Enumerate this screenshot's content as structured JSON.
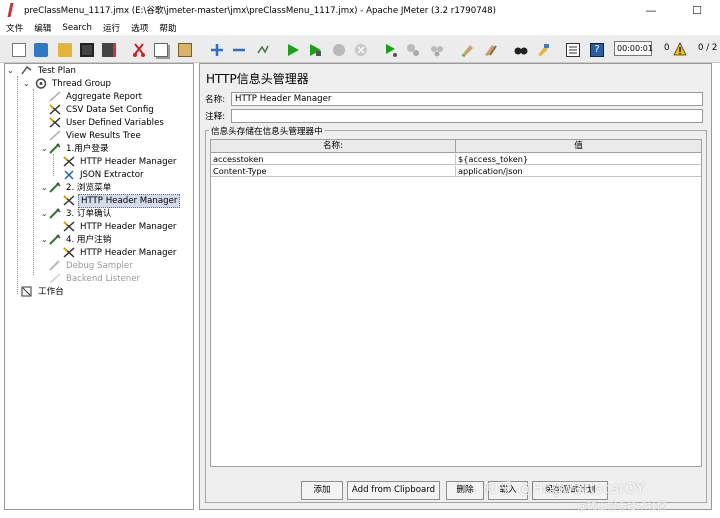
{
  "window": {
    "title": "preClassMenu_1117.jmx (E:\\谷歌\\jmeter-master\\jmx\\preClassMenu_1117.jmx) - Apache JMeter (3.2 r1790748)",
    "minimize": "—",
    "maximize": "☐",
    "close": "✕"
  },
  "menu": [
    "文件",
    "编辑",
    "Search",
    "运行",
    "选项",
    "帮助"
  ],
  "toolbar": {
    "timer": "00:00:01",
    "errors": "0",
    "threads": "0 / 2",
    "warning_color": "#f2c200",
    "run_color": "#1aa31a",
    "stop_color": "#b8b8b8",
    "icons": [
      "new-icon",
      "templates-icon",
      "open-icon",
      "save-icon",
      "save-as-icon",
      "cut-icon",
      "copy-icon",
      "paste-icon",
      "expand-icon",
      "collapse-icon",
      "toggle-icon",
      "start-icon",
      "start-no-pause-icon",
      "stop-icon",
      "shutdown-icon",
      "remote-start-icon",
      "remote-stop-icon",
      "remote-shutdown-icon",
      "clear-icon",
      "clear-all-icon",
      "search-icon",
      "reset-search-icon",
      "function-helper-icon",
      "help-icon"
    ]
  },
  "tree": [
    {
      "label": "Test Plan",
      "icon": "test-plan-icon"
    },
    {
      "label": "Thread Group",
      "icon": "thread-group-icon"
    },
    {
      "label": "Aggregate Report",
      "icon": "listener-icon"
    },
    {
      "label": "CSV Data Set Config",
      "icon": "config-icon"
    },
    {
      "label": "User Defined Variables",
      "icon": "config-icon"
    },
    {
      "label": "View Results Tree",
      "icon": "listener-icon"
    },
    {
      "label": "1.用户登录",
      "icon": "sampler-icon"
    },
    {
      "label": "HTTP Header Manager",
      "icon": "config-icon"
    },
    {
      "label": "JSON Extractor",
      "icon": "extractor-icon"
    },
    {
      "label": "2. 浏览菜单",
      "icon": "sampler-icon"
    },
    {
      "label": "HTTP Header Manager",
      "icon": "config-icon",
      "selected": true
    },
    {
      "label": "3. 订单确认",
      "icon": "sampler-icon"
    },
    {
      "label": "HTTP Header Manager",
      "icon": "config-icon"
    },
    {
      "label": "4. 用户注销",
      "icon": "sampler-icon"
    },
    {
      "label": "HTTP Header Manager",
      "icon": "config-icon"
    },
    {
      "label": "Debug Sampler",
      "icon": "sampler-icon",
      "disabled": true
    },
    {
      "label": "Backend Listener",
      "icon": "listener-icon",
      "disabled": true
    },
    {
      "label": "工作台",
      "icon": "workbench-icon"
    }
  ],
  "panel": {
    "title": "HTTP信息头管理器",
    "name_label": "名称:",
    "name_value": "HTTP Header Manager",
    "comment_label": "注释:",
    "comment_value": "",
    "group_title": "信息头存储在信息头管理器中",
    "columns": [
      "名称:",
      "值"
    ],
    "rows": [
      [
        "accesstoken",
        "${access_token}"
      ],
      [
        "Content-Type",
        "application/json"
      ]
    ]
  },
  "buttons": {
    "add": "添加",
    "add_from_clipboard": "Add from Clipboard",
    "delete": "删除",
    "load": "载入",
    "save_as": "保存测试计划"
  },
  "watermark": {
    "line1": "知乎 @HogwartscsrOY",
    "line2": "@稀土掘金技术社区"
  }
}
